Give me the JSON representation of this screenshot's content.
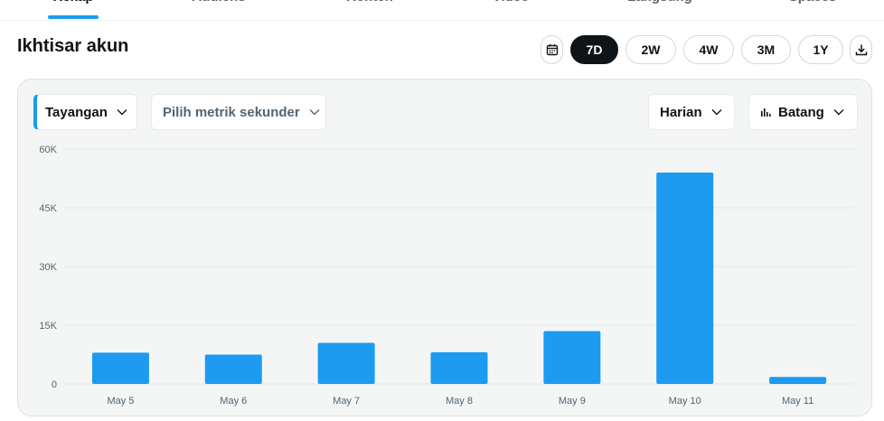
{
  "tabs": [
    {
      "label": "Rekap",
      "active": true
    },
    {
      "label": "Audiens",
      "active": false
    },
    {
      "label": "Konten",
      "active": false
    },
    {
      "label": "Video",
      "active": false
    },
    {
      "label": "Langsung",
      "active": false
    },
    {
      "label": "Spaces",
      "active": false
    }
  ],
  "title": "Ikhtisar akun",
  "range": {
    "calendar_icon": "calendar-icon",
    "options": [
      "7D",
      "2W",
      "4W",
      "3M",
      "1Y"
    ],
    "selected": "7D",
    "download_icon": "download-icon"
  },
  "controls": {
    "primary_metric": "Tayangan",
    "secondary_metric_placeholder": "Pilih metrik sekunder",
    "interval": "Harian",
    "chart_type": "Batang"
  },
  "colors": {
    "accent": "#1d9bf0",
    "dark": "#0f1419",
    "muted": "#536471",
    "card_bg": "#f4f6f5"
  },
  "chart_data": {
    "type": "bar",
    "categories": [
      "May 5",
      "May 6",
      "May 7",
      "May 8",
      "May 9",
      "May 10",
      "May 11"
    ],
    "series": [
      {
        "values": [
          8000,
          7500,
          10500,
          8100,
          13500,
          54000,
          1800
        ]
      }
    ],
    "yticks": [
      0,
      15000,
      30000,
      45000,
      60000
    ],
    "ytick_labels": [
      "0",
      "15K",
      "30K",
      "45K",
      "60K"
    ],
    "ylim": [
      0,
      60000
    ],
    "grid": true,
    "legend": "none"
  }
}
